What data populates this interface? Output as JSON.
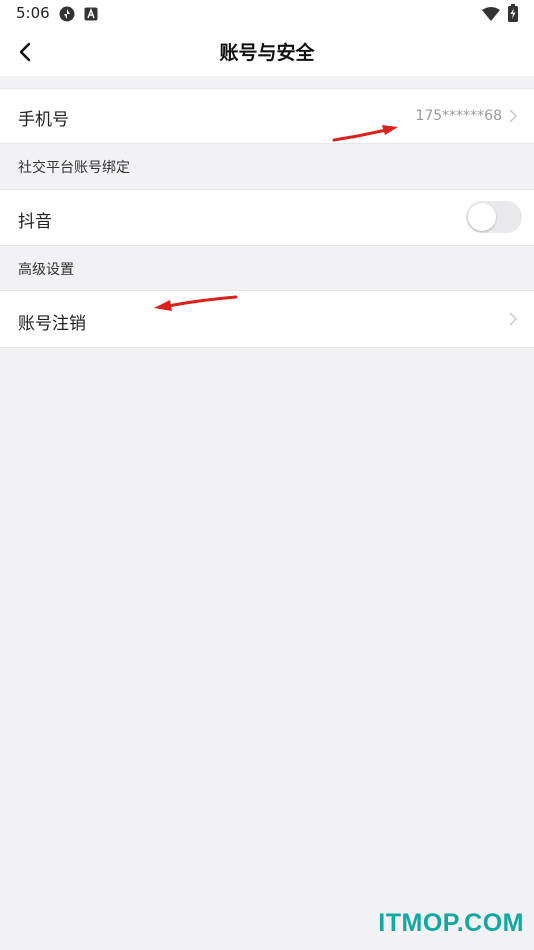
{
  "status_bar": {
    "time": "5:06",
    "icons": [
      "sync-icon",
      "a-badge-icon",
      "wifi-icon",
      "battery-charging-icon"
    ]
  },
  "nav": {
    "back_icon": "chevron-left-icon",
    "title": "账号与安全"
  },
  "rows": {
    "phone": {
      "label": "手机号",
      "value": "175******68"
    },
    "social_section": "社交平台账号绑定",
    "douyin": {
      "label": "抖音",
      "toggle_on": false
    },
    "advanced_section": "高级设置",
    "cancel_account": {
      "label": "账号注销"
    }
  },
  "annotations": {
    "arrow_color": "#d9221c"
  },
  "watermark": "ITMOP.COM",
  "colors": {
    "background": "#f2f2f4",
    "card": "#ffffff",
    "secondary_text": "#9a9a9a",
    "watermark": "#10a8a0"
  }
}
